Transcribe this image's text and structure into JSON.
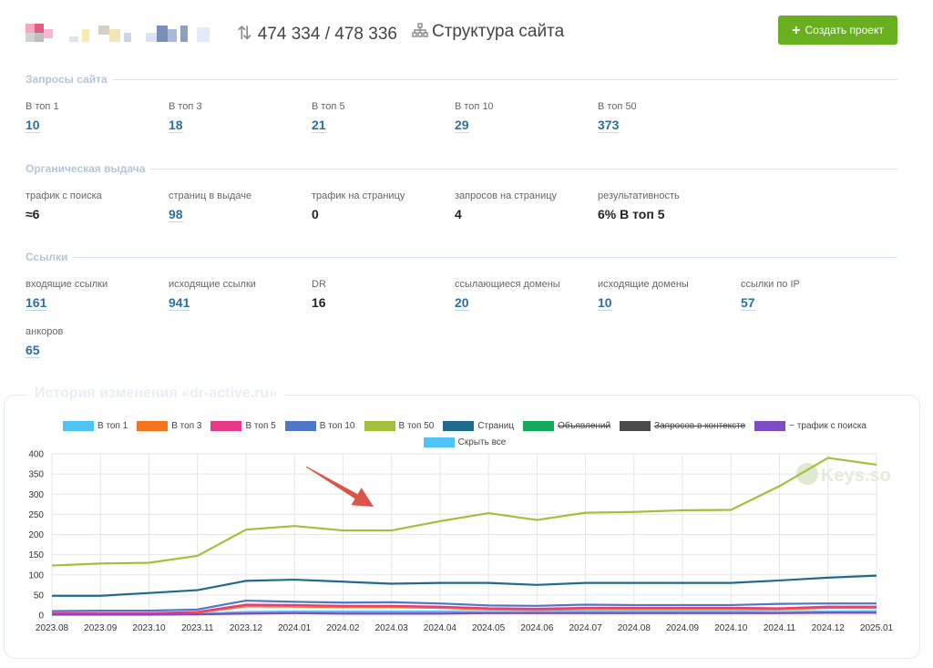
{
  "header": {
    "counter_icon": "sort-arrows-icon",
    "counter_text": "474 334 / 478 336",
    "structure_icon": "sitemap-icon",
    "structure_label": "Структура сайта",
    "create_label": "Создать проект",
    "create_icon": "plus-icon"
  },
  "sections": {
    "queries": {
      "title": "Запросы сайта",
      "items": [
        {
          "label": "В топ 1",
          "value": "10"
        },
        {
          "label": "В топ 3",
          "value": "18"
        },
        {
          "label": "В топ 5",
          "value": "21"
        },
        {
          "label": "В топ 10",
          "value": "29"
        },
        {
          "label": "В топ 50",
          "value": "373"
        }
      ]
    },
    "organic": {
      "title": "Органическая выдача",
      "items": [
        {
          "label": "трафик с поиска",
          "value": "≈6"
        },
        {
          "label": "страниц в выдаче",
          "value": "98"
        },
        {
          "label": "трафик на страницу",
          "value": "0"
        },
        {
          "label": "запросов на страницу",
          "value": "4"
        },
        {
          "label": "результативность",
          "value": "6% В топ 5"
        }
      ]
    },
    "links": {
      "title": "Ссылки",
      "items": [
        {
          "label": "входящие ссылки",
          "value": "161"
        },
        {
          "label": "исходящие ссылки",
          "value": "941"
        },
        {
          "label": "DR",
          "value": "16"
        },
        {
          "label": "ссылающиеся домены",
          "value": "20"
        },
        {
          "label": "исходящие домены",
          "value": "10"
        },
        {
          "label": "ссылки по IP",
          "value": "57"
        },
        {
          "label": "анкоров",
          "value": "65"
        }
      ]
    }
  },
  "history": {
    "title": "История изменения «dr-active.ru»",
    "watermark": "Keys.so"
  },
  "chart_data": {
    "type": "line",
    "categories": [
      "2023.08",
      "2023.09",
      "2023.10",
      "2023.11",
      "2023.12",
      "2024.01",
      "2024.02",
      "2024.03",
      "2024.04",
      "2024.05",
      "2024.06",
      "2024.07",
      "2024.08",
      "2024.09",
      "2024.10",
      "2024.11",
      "2024.12",
      "2025.01"
    ],
    "ylim": [
      0,
      400
    ],
    "yticks": [
      "0",
      "50",
      "100",
      "150",
      "200",
      "250",
      "300",
      "350",
      "400"
    ],
    "grid": true,
    "legend_position": "top",
    "series": [
      {
        "name": "В топ 1",
        "color": "#4fc3f7",
        "enabled": true,
        "values": [
          2,
          2,
          2,
          3,
          8,
          9,
          9,
          9,
          9,
          8,
          8,
          9,
          9,
          9,
          9,
          8,
          9,
          10
        ]
      },
      {
        "name": "В топ 3",
        "color": "#f4731c",
        "enabled": true,
        "values": [
          4,
          4,
          4,
          6,
          22,
          21,
          20,
          20,
          18,
          14,
          13,
          15,
          15,
          15,
          15,
          14,
          18,
          18
        ]
      },
      {
        "name": "В топ 5",
        "color": "#e8388a",
        "enabled": true,
        "values": [
          5,
          5,
          5,
          8,
          26,
          25,
          23,
          23,
          21,
          17,
          16,
          18,
          18,
          18,
          18,
          17,
          21,
          21
        ]
      },
      {
        "name": "В топ 10",
        "color": "#4f76c7",
        "enabled": true,
        "values": [
          10,
          11,
          11,
          14,
          36,
          33,
          31,
          32,
          29,
          24,
          23,
          26,
          25,
          25,
          25,
          28,
          29,
          29
        ]
      },
      {
        "name": "В топ 50",
        "color": "#a3c03a",
        "enabled": true,
        "values": [
          123,
          128,
          130,
          147,
          212,
          221,
          210,
          210,
          233,
          253,
          236,
          254,
          256,
          260,
          261,
          320,
          390,
          373
        ]
      },
      {
        "name": "Страниц",
        "color": "#1f6b8e",
        "enabled": true,
        "values": [
          48,
          48,
          55,
          62,
          85,
          88,
          83,
          78,
          80,
          80,
          75,
          80,
          80,
          80,
          80,
          86,
          93,
          98
        ]
      },
      {
        "name": "Объявлений",
        "color": "#13a85a",
        "enabled": false,
        "values": []
      },
      {
        "name": "Запросов в контексте",
        "color": "#4a4a4a",
        "enabled": false,
        "values": []
      },
      {
        "name": "~ трафик с поиска",
        "color": "#7e4bc0",
        "enabled": true,
        "values": [
          1,
          1,
          1,
          2,
          4,
          5,
          4,
          4,
          4,
          5,
          5,
          5,
          5,
          5,
          5,
          5,
          6,
          6
        ]
      },
      {
        "name": "Скрыть все",
        "color": "#4fc3f7",
        "enabled": true,
        "values": []
      }
    ]
  }
}
